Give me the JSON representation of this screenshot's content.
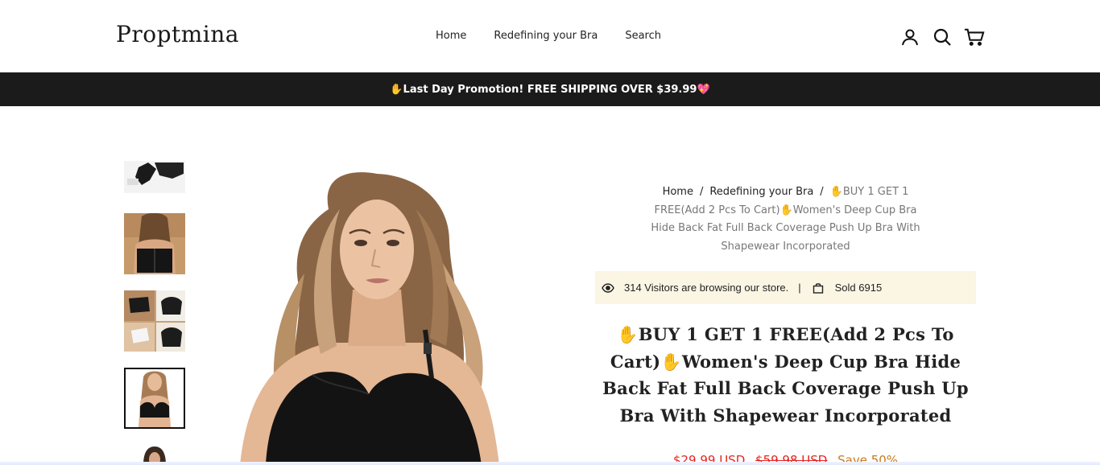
{
  "header": {
    "logo": "Proptmina",
    "nav": [
      "Home",
      "Redefining your Bra",
      "Search"
    ],
    "icons": [
      "account-icon",
      "search-icon",
      "cart-icon"
    ]
  },
  "announcement": {
    "text": "✋Last Day Promotion! FREE SHIPPING OVER $39.99💖"
  },
  "gallery": {
    "thumbnail_count": 5,
    "active_index": 3
  },
  "breadcrumb": {
    "home": "Home",
    "collection": "Redefining your Bra",
    "current": "✋BUY 1 GET 1 FREE(Add 2 Pcs To Cart)✋Women's Deep Cup Bra Hide Back Fat Full Back Coverage Push Up Bra With Shapewear Incorporated"
  },
  "stats": {
    "visitors": "314 Visitors are browsing our store.",
    "divider": "|",
    "sold": "Sold 6915"
  },
  "product": {
    "title": "✋BUY 1 GET 1 FREE(Add 2 Pcs To Cart)✋Women's Deep Cup Bra Hide Back Fat Full Back Coverage Push Up Bra With Shapewear Incorporated",
    "price": "$29.99 USD",
    "compare_price": "$59.98 USD",
    "save": "Save 50%"
  },
  "colors": {
    "announcement_bg": "#1b1b1b",
    "stats_bg": "#fbf6e4",
    "price": "#e2261e",
    "save": "#c97a1a"
  }
}
